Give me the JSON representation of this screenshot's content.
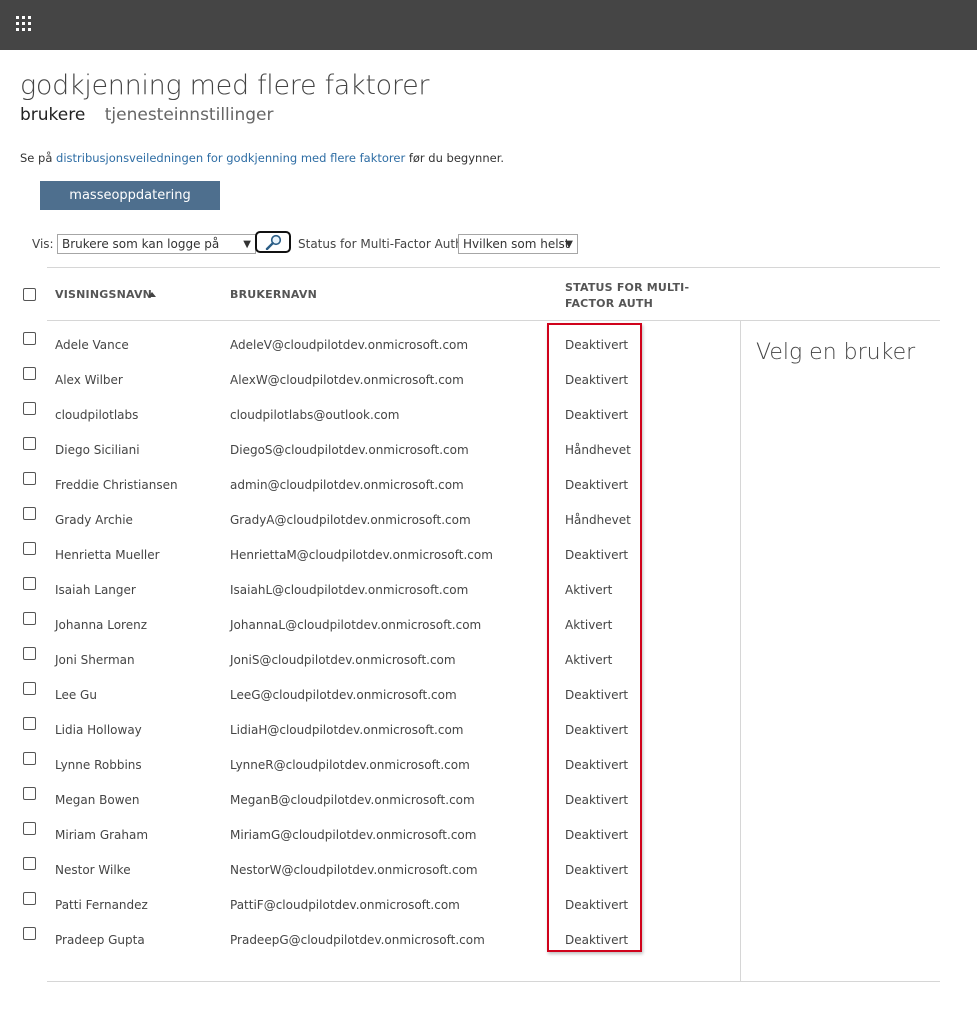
{
  "header": {
    "app_launcher_icon": "waffle-grid-icon"
  },
  "page": {
    "title": "godkjenning med flere faktorer",
    "tabs": [
      {
        "label": "brukere",
        "active": true
      },
      {
        "label": "tjenesteinnstillinger",
        "active": false
      }
    ],
    "guide": {
      "prefix": "Se på ",
      "link": "distribusjonsveiledningen for godkjenning med flere faktorer",
      "suffix": " før du begynner."
    },
    "bulk_update_label": "masseoppdatering"
  },
  "filters": {
    "view_label": "Vis:",
    "view_value": "Brukere som kan logge på",
    "search_icon": "magnifier-icon",
    "status_label": "Status for Multi-Factor Auth:",
    "status_value": "Hvilken som helst"
  },
  "table": {
    "headers": {
      "display_name": "VISNINGSNAVN",
      "username": "BRUKERNAVN",
      "status_line1": "STATUS FOR MULTI-",
      "status_line2": "FACTOR AUTH"
    },
    "sort": {
      "column": "VISNINGSNAVN",
      "direction": "ascending"
    },
    "rows": [
      {
        "name": "Adele Vance",
        "username": "AdeleV@cloudpilotdev.onmicrosoft.com",
        "status": "Deaktivert"
      },
      {
        "name": "Alex Wilber",
        "username": "AlexW@cloudpilotdev.onmicrosoft.com",
        "status": "Deaktivert"
      },
      {
        "name": "cloudpilotlabs",
        "username": "cloudpilotlabs@outlook.com",
        "status": "Deaktivert"
      },
      {
        "name": "Diego Siciliani",
        "username": "DiegoS@cloudpilotdev.onmicrosoft.com",
        "status": "Håndhevet"
      },
      {
        "name": "Freddie Christiansen",
        "username": "admin@cloudpilotdev.onmicrosoft.com",
        "status": "Deaktivert"
      },
      {
        "name": "Grady Archie",
        "username": "GradyA@cloudpilotdev.onmicrosoft.com",
        "status": "Håndhevet"
      },
      {
        "name": "Henrietta Mueller",
        "username": "HenriettaM@cloudpilotdev.onmicrosoft.com",
        "status": "Deaktivert"
      },
      {
        "name": "Isaiah Langer",
        "username": "IsaiahL@cloudpilotdev.onmicrosoft.com",
        "status": "Aktivert"
      },
      {
        "name": "Johanna Lorenz",
        "username": "JohannaL@cloudpilotdev.onmicrosoft.com",
        "status": "Aktivert"
      },
      {
        "name": "Joni Sherman",
        "username": "JoniS@cloudpilotdev.onmicrosoft.com",
        "status": "Aktivert"
      },
      {
        "name": "Lee Gu",
        "username": "LeeG@cloudpilotdev.onmicrosoft.com",
        "status": "Deaktivert"
      },
      {
        "name": "Lidia Holloway",
        "username": "LidiaH@cloudpilotdev.onmicrosoft.com",
        "status": "Deaktivert"
      },
      {
        "name": "Lynne Robbins",
        "username": "LynneR@cloudpilotdev.onmicrosoft.com",
        "status": "Deaktivert"
      },
      {
        "name": "Megan Bowen",
        "username": "MeganB@cloudpilotdev.onmicrosoft.com",
        "status": "Deaktivert"
      },
      {
        "name": "Miriam Graham",
        "username": "MiriamG@cloudpilotdev.onmicrosoft.com",
        "status": "Deaktivert"
      },
      {
        "name": "Nestor Wilke",
        "username": "NestorW@cloudpilotdev.onmicrosoft.com",
        "status": "Deaktivert"
      },
      {
        "name": "Patti Fernandez",
        "username": "PattiF@cloudpilotdev.onmicrosoft.com",
        "status": "Deaktivert"
      },
      {
        "name": "Pradeep Gupta",
        "username": "PradeepG@cloudpilotdev.onmicrosoft.com",
        "status": "Deaktivert"
      }
    ]
  },
  "detail_panel": {
    "title": "Velg en bruker"
  },
  "colors": {
    "topbar": "#454545",
    "button": "#4e6f8e",
    "link": "#2e6da4",
    "highlight": "#d0021b"
  }
}
